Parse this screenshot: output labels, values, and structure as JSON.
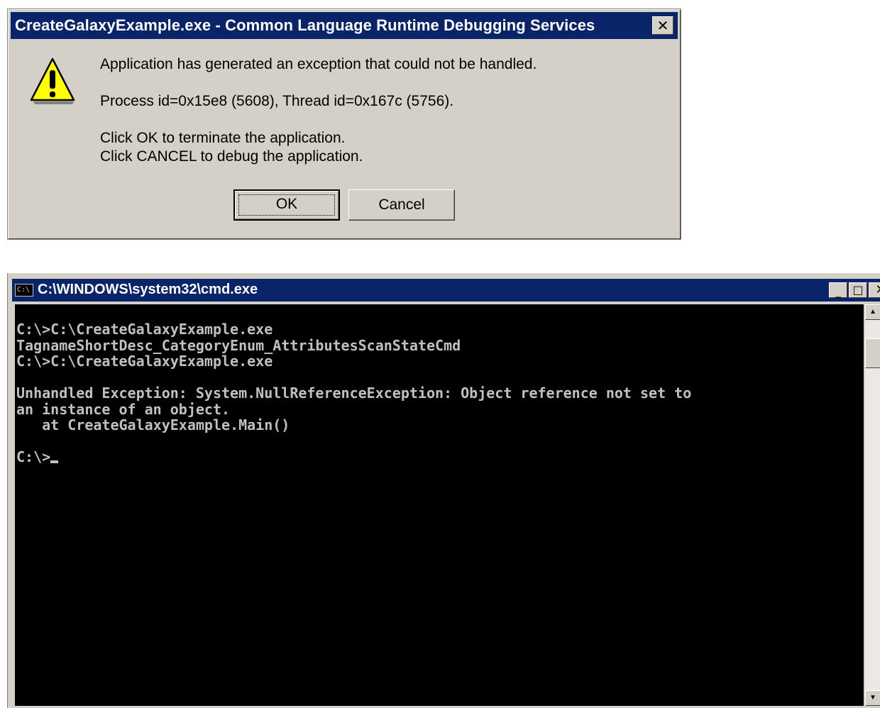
{
  "dialog": {
    "title": "CreateGalaxyExample.exe - Common Language Runtime Debugging Services",
    "close_glyph": "✕",
    "icon": "warning-icon",
    "message_line1": "Application has generated an exception that could not be handled.",
    "message_line2": "Process id=0x15e8 (5608), Thread id=0x167c (5756).",
    "message_line3": "Click OK to terminate the application.",
    "message_line4": "Click CANCEL to debug the application.",
    "ok_label": "OK",
    "cancel_label": "Cancel"
  },
  "console_window": {
    "title": "C:\\WINDOWS\\system32\\cmd.exe",
    "icon_text": "C:\\",
    "min_glyph": "_",
    "max_glyph": "□",
    "close_glyph": "✕",
    "lines": [
      "C:\\>C:\\CreateGalaxyExample.exe",
      "TagnameShortDesc_CategoryEnum_AttributesScanStateCmd",
      "C:\\>C:\\CreateGalaxyExample.exe",
      "",
      "Unhandled Exception: System.NullReferenceException: Object reference not set to",
      "an instance of an object.",
      "   at CreateGalaxyExample.Main()",
      ""
    ],
    "prompt": "C:\\>",
    "scroll_up_glyph": "▲",
    "scroll_down_glyph": "▼"
  },
  "colors": {
    "titlebar": "#0a246a",
    "window_face": "#d4d0c8",
    "console_bg": "#000000",
    "console_text": "#c0c0c0"
  }
}
